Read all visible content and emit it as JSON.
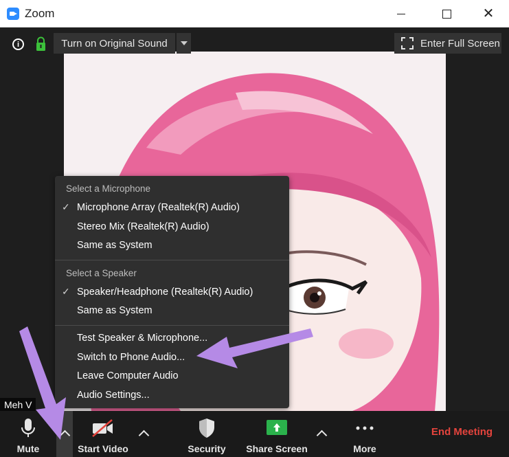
{
  "window": {
    "title": "Zoom"
  },
  "top_bar": {
    "original_sound_label": "Turn on Original Sound",
    "fullscreen_label": "Enter Full Screen"
  },
  "audio_menu": {
    "mic_header": "Select a Microphone",
    "mic_items": [
      {
        "label": "Microphone Array (Realtek(R) Audio)",
        "checked": true
      },
      {
        "label": "Stereo Mix (Realtek(R) Audio)",
        "checked": false
      },
      {
        "label": "Same as System",
        "checked": false
      }
    ],
    "speaker_header": "Select a Speaker",
    "speaker_items": [
      {
        "label": "Speaker/Headphone (Realtek(R) Audio)",
        "checked": true
      },
      {
        "label": "Same as System",
        "checked": false
      }
    ],
    "actions": [
      "Test Speaker & Microphone...",
      "Switch to Phone Audio...",
      "Leave Computer Audio",
      "Audio Settings..."
    ]
  },
  "participant": {
    "name": "Meh V"
  },
  "toolbar": {
    "mute": "Mute",
    "start_video": "Start Video",
    "security": "Security",
    "share_screen": "Share Screen",
    "more": "More",
    "end_meeting": "End Meeting"
  },
  "colors": {
    "accent": "#2d8cff",
    "share_green": "#2bb24c",
    "end_red": "#e5443d",
    "annotation_purple": "#b58ae6",
    "video_pink": "#e8669a"
  }
}
